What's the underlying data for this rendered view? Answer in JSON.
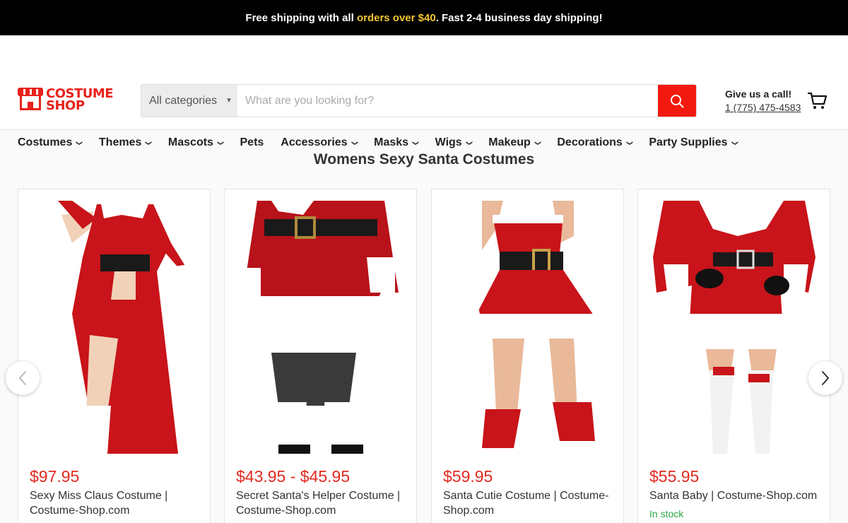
{
  "announcement": {
    "part1": "Free shipping with all ",
    "highlight": "orders over $40",
    "part2": ". Fast 2-4 business day shipping!"
  },
  "logo": {
    "line1": "COSTUME",
    "line2": "SHOP"
  },
  "search": {
    "category": "All categories",
    "placeholder": "What are you looking for?"
  },
  "contact": {
    "title": "Give us a call!",
    "phone": "1 (775) 475-4583"
  },
  "nav": [
    {
      "label": "Costumes",
      "dropdown": true
    },
    {
      "label": "Themes",
      "dropdown": true
    },
    {
      "label": "Mascots",
      "dropdown": true
    },
    {
      "label": "Pets",
      "dropdown": false
    },
    {
      "label": "Accessories",
      "dropdown": true
    },
    {
      "label": "Masks",
      "dropdown": true
    },
    {
      "label": "Wigs",
      "dropdown": true
    },
    {
      "label": "Makeup",
      "dropdown": true
    },
    {
      "label": "Decorations",
      "dropdown": true
    },
    {
      "label": "Party Supplies",
      "dropdown": true
    }
  ],
  "heading": "Womens Sexy Santa Costumes",
  "products": [
    {
      "price": "$97.95",
      "title": "Sexy Miss Claus Costume | Costume-Shop.com",
      "stock": ""
    },
    {
      "price": "$43.95 - $45.95",
      "title": "Secret Santa's Helper Costume | Costume-Shop.com",
      "stock": ""
    },
    {
      "price": "$59.95",
      "title": "Santa Cutie Costume | Costume-Shop.com",
      "stock": ""
    },
    {
      "price": "$55.95",
      "title": "Santa Baby | Costume-Shop.com",
      "stock": "In stock"
    }
  ],
  "colors": {
    "brand_red": "#e8211b",
    "search_button": "#f21a10",
    "price": "#e22a1f",
    "in_stock": "#2aa545"
  },
  "icons": {
    "search": "search-icon",
    "cart": "cart-icon",
    "prev": "chevron-left-icon",
    "next": "chevron-right-icon"
  }
}
